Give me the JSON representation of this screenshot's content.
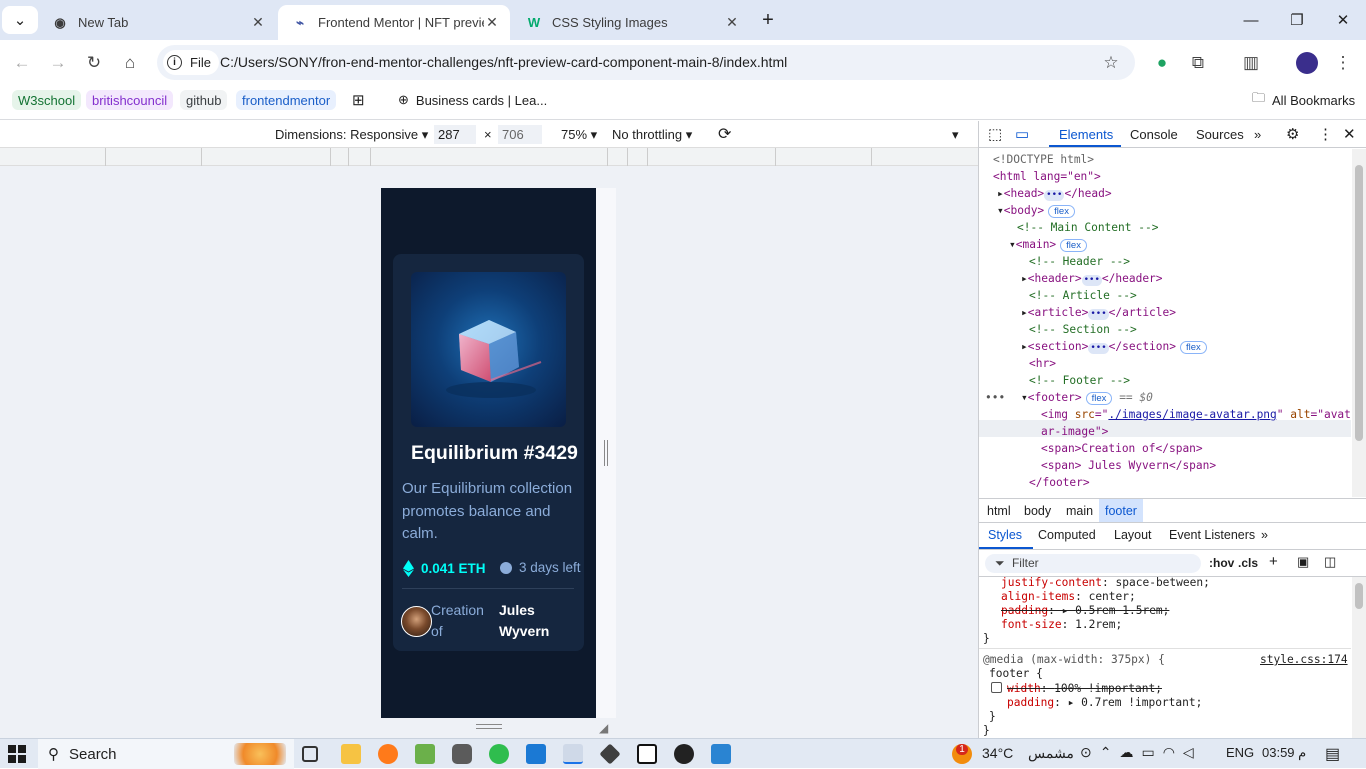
{
  "tabs": [
    {
      "title": "New Tab",
      "icon": "chrome-icon"
    },
    {
      "title": "Frontend Mentor | NFT preview",
      "icon": "frontend-mentor-icon"
    },
    {
      "title": "CSS Styling Images",
      "icon": "w3schools-icon"
    }
  ],
  "toolbar": {
    "file_chip": "File",
    "url": "C:/Users/SONY/fron-end-mentor-challenges/nft-preview-card-component-main-8/index.html"
  },
  "bookmarks": [
    "W3school",
    "britishcouncil",
    "github",
    "frontendmentor",
    "Business cards | Lea...",
    "All Bookmarks"
  ],
  "devicebar": {
    "dimensions": "Dimensions: Responsive",
    "width": "287",
    "times": "×",
    "height": "706",
    "zoom": "75%",
    "throttle": "No throttling"
  },
  "card": {
    "title": "Equilibrium #3429",
    "description": "Our Equilibrium collection promotes balance and calm.",
    "price": "0.041 ETH",
    "days": "3 days left",
    "creation": "Creation of",
    "author": "Jules Wyvern"
  },
  "devtools": {
    "tabs": [
      "Elements",
      "Console",
      "Sources"
    ],
    "dom": [
      "<!DOCTYPE html>",
      "<html lang=\"en\">",
      "<head>",
      "</head>",
      "<body>",
      "<!-- Main Content -->",
      "<main>",
      "<!-- Header -->",
      "<header>",
      "</header>",
      "<!-- Article -->",
      "<article>",
      "</article>",
      "<!-- Section -->",
      "<section>",
      "</section>",
      "<hr>",
      "<!-- Footer -->",
      "<footer>",
      "== $0",
      "<img src=\"",
      "./images/image-avatar.png",
      "\" alt=\"avat",
      "ar-image\">",
      "<span>Creation of</span>",
      "<span> Jules Wyvern</span>",
      "</footer>",
      "flex"
    ],
    "breadcrumbs": [
      "html",
      "body",
      "main",
      "footer"
    ],
    "subtabs": [
      "Styles",
      "Computed",
      "Layout",
      "Event Listeners"
    ],
    "filter_placeholder": "Filter",
    "filter_tools": [
      ":hov",
      ".cls"
    ],
    "css": [
      {
        "prop": "justify-content",
        "value": "space-between;"
      },
      {
        "prop": "align-items",
        "value": "center;"
      },
      {
        "prop": "padding",
        "value": "0.5rem 1.5rem;"
      },
      {
        "prop": "font-size",
        "value": "1.2rem;"
      }
    ],
    "media": "@media (max-width: 375px) {",
    "media_selector": "footer {",
    "media_source": "style.css:174",
    "media_props": [
      {
        "prop": "width",
        "value": "100% !important;"
      },
      {
        "prop": "padding",
        "value": "0.7rem !important;"
      }
    ]
  },
  "taskbar": {
    "search": "Search",
    "temperature": "34°C",
    "weather": "مشمس",
    "language": "ENG",
    "time": "03:59 م",
    "badge": "1"
  }
}
